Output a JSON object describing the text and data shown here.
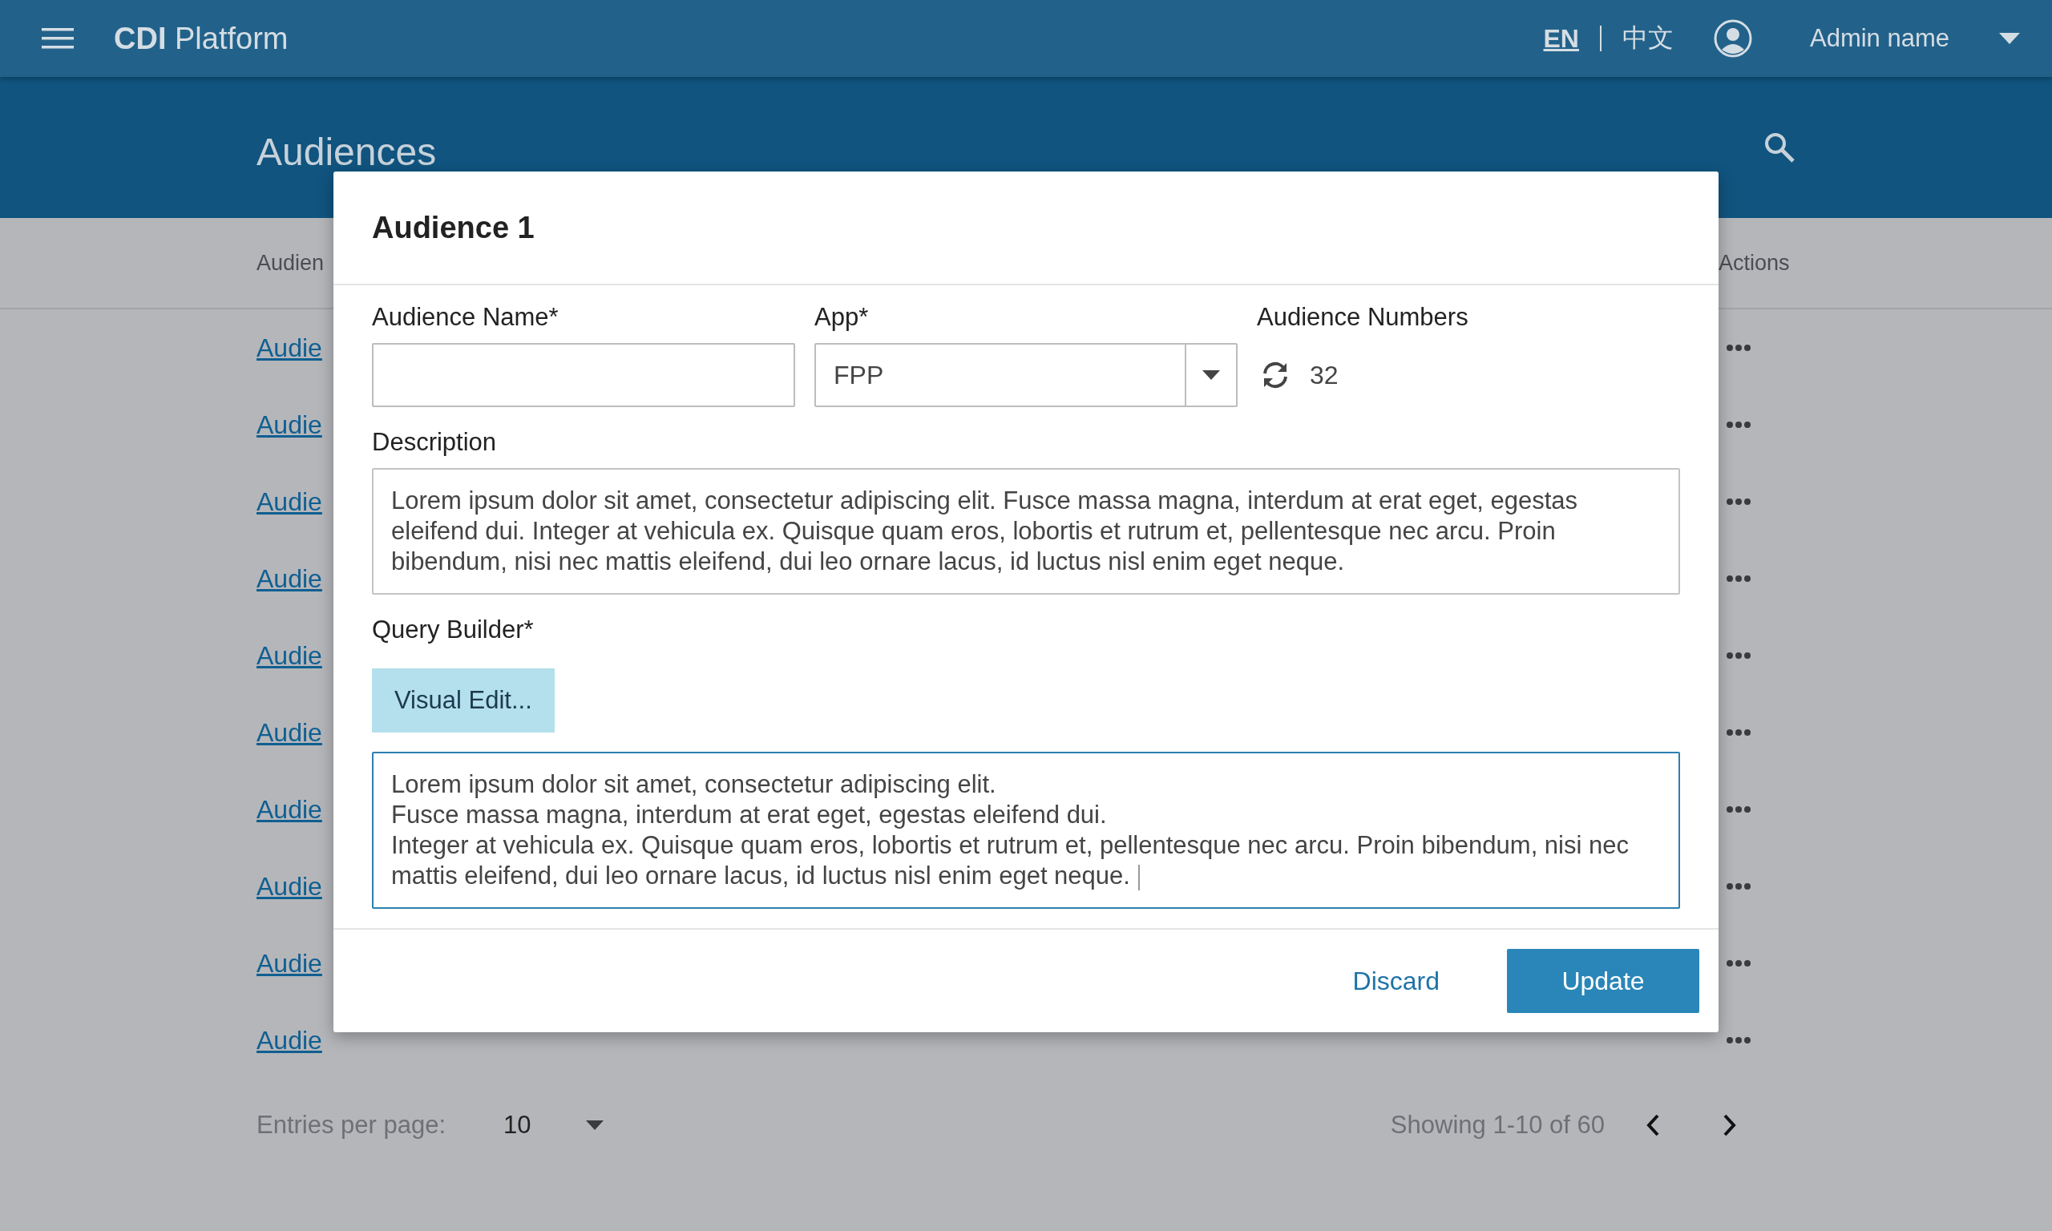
{
  "top_bar": {
    "title_bold": "CDI",
    "title": "Platform",
    "languages": [
      {
        "label": "EN",
        "selected": true
      },
      {
        "label": "中文",
        "selected": false
      }
    ],
    "user": "Admin name"
  },
  "page": {
    "title": "Audiences"
  },
  "table": {
    "columns": [
      "Audien",
      "Actions"
    ],
    "rows": [
      "Audie",
      "Audie",
      "Audie",
      "Audie",
      "Audie",
      "Audie",
      "Audie",
      "Audie",
      "Audie",
      "Audie"
    ]
  },
  "pagination": {
    "entries_label": "Entries per page:",
    "entries_value": "10",
    "showing": "Showing 1-10 of 60"
  },
  "dialog": {
    "title": "Audience 1",
    "name_field": {
      "label": "Audience Name*"
    },
    "app_field": {
      "label": "App*",
      "value": "FPP"
    },
    "numbers": {
      "label": "Audience Numbers",
      "value": "32"
    },
    "description": {
      "label": "Description",
      "value": "Lorem ipsum dolor sit amet, consectetur adipiscing elit. Fusce massa magna, interdum at erat eget, egestas eleifend dui. Integer at vehicula ex. Quisque quam eros, lobortis et rutrum et, pellentesque nec arcu. Proin bibendum, nisi nec mattis eleifend, dui leo ornare lacus, id luctus nisl enim eget neque."
    },
    "query": {
      "label": "Query Builder*",
      "button": "Visual Edit...",
      "value": "Lorem ipsum dolor sit amet, consectetur adipiscing elit.\nFusce massa magna, interdum at erat eget, egestas eleifend dui.\nInteger at vehicula ex. Quisque quam eros, lobortis et rutrum et, pellentesque nec arcu. Proin bibendum, nisi nec mattis eleifend, dui leo ornare lacus, id luctus nisl enim eget neque.",
      "focused": true
    },
    "buttons": [
      {
        "label": "Discard",
        "kind": "text"
      },
      {
        "label": "Update",
        "kind": "primary"
      }
    ]
  }
}
